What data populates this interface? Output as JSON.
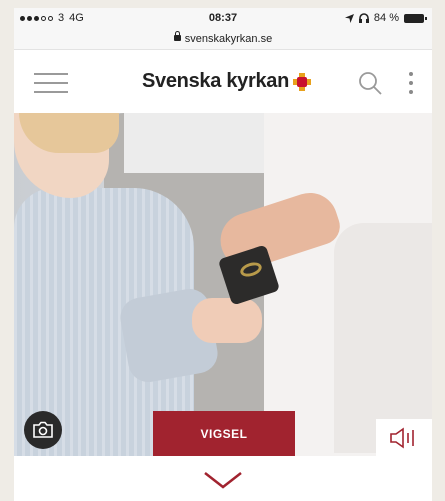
{
  "status_bar": {
    "carrier": "3",
    "network": "4G",
    "time": "08:37",
    "battery": "84 %"
  },
  "url_bar": {
    "domain": "svenskakyrkan.se"
  },
  "header": {
    "logo_text": "Svenska kyrkan",
    "icons": [
      "menu-icon",
      "search-icon",
      "more-icon"
    ]
  },
  "hero": {
    "button_label": "VIGSEL",
    "icons": [
      "camera-icon",
      "speaker-icon"
    ]
  },
  "footer": {
    "icons": [
      "chevron-down-icon"
    ]
  },
  "colors": {
    "accent": "#a1232f",
    "logo_yellow": "#e8a11c",
    "logo_red": "#c8102e"
  }
}
